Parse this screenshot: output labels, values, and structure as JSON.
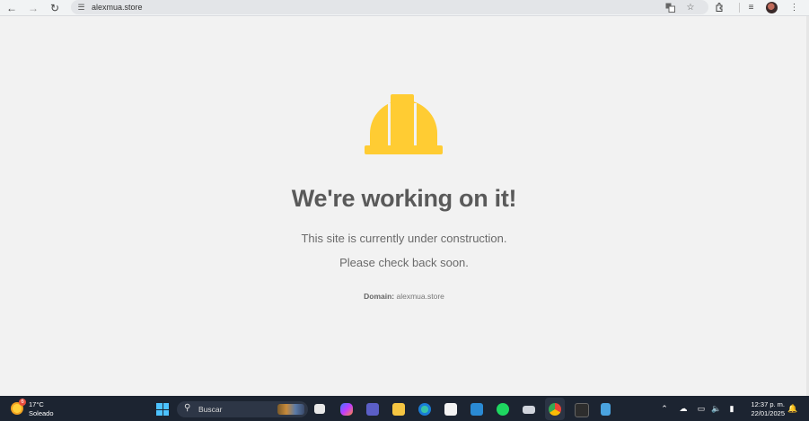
{
  "browser": {
    "url": "alexmua.store",
    "icons": {
      "back": "arrow-left-icon",
      "forward": "arrow-right-icon",
      "reload": "reload-icon",
      "site_info": "tune-icon",
      "translate": "translate-icon",
      "bookmark": "star-icon",
      "extensions": "puzzle-icon",
      "media": "media-queue-icon",
      "menu": "kebab-icon"
    }
  },
  "page": {
    "headline": "We're working on it!",
    "line1": "This site is currently under construction.",
    "line2": "Please check back soon.",
    "domain_label": "Domain:",
    "domain_value": "alexmua.store",
    "helmet_color": "#FFCC33",
    "text_color": "#5a5a5a"
  },
  "taskbar": {
    "weather": {
      "badge": "6",
      "temp": "17°C",
      "condition": "Soleado"
    },
    "search_placeholder": "Buscar",
    "apps": [
      "task-view",
      "copilot",
      "teams",
      "file-explorer",
      "edge",
      "microsoft-store",
      "app-tile",
      "spotify",
      "game-controller",
      "chrome",
      "terminal",
      "notepad"
    ],
    "clock": {
      "time": "12:37 p. m.",
      "date": "22/01/2025"
    }
  }
}
